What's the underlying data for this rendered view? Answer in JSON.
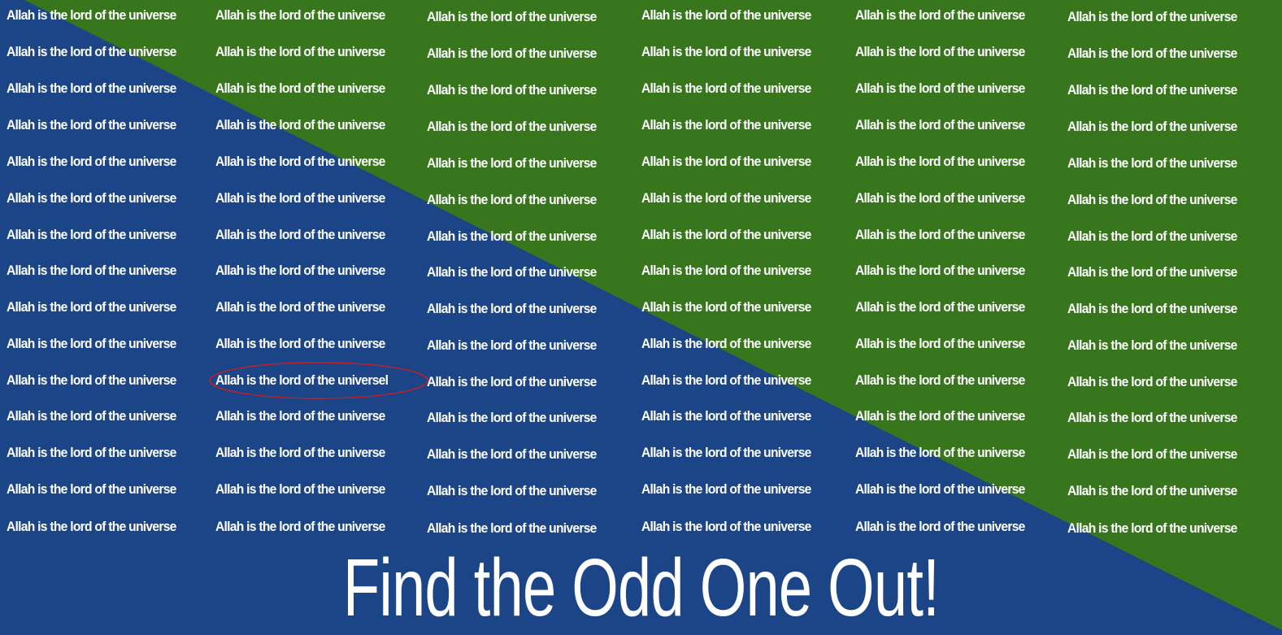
{
  "puzzle": {
    "title": "Find the Odd One Out!",
    "grid": {
      "columns": 6,
      "rows": 15,
      "repeated_text": "Allah is the lord of the universe",
      "odd_text": "Allah is the lord of the universel",
      "odd_cell": {
        "row": 11,
        "column": 2
      }
    },
    "highlight_color": "#c0202a",
    "colors": {
      "green": "#38761d",
      "blue": "#1c4587",
      "text": "#ffffff"
    }
  }
}
